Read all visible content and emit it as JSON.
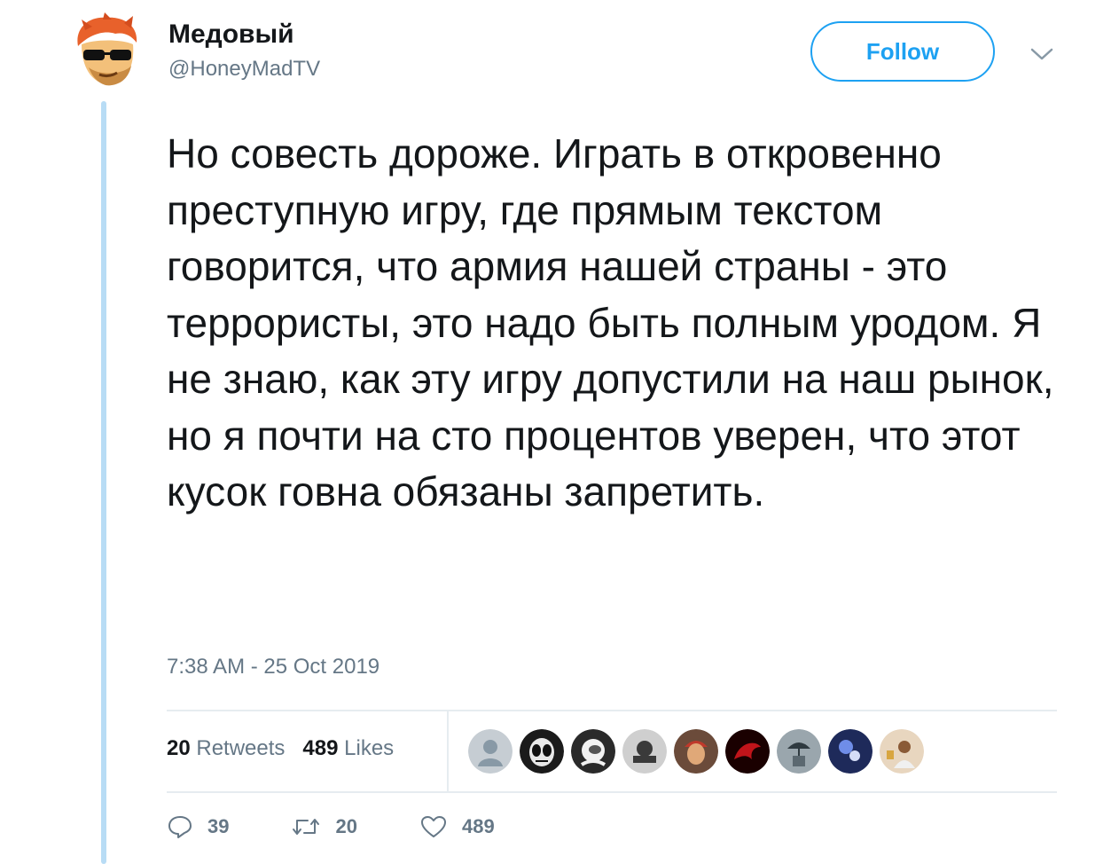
{
  "user": {
    "display_name": "Медовый",
    "handle": "@HoneyMadTV"
  },
  "follow_label": "Follow",
  "tweet": {
    "text": "Но совесть дороже. Играть в откровенно преступную игру, где прямым текстом говорится, что армия нашей страны - это террористы, это надо быть полным уродом. Я не знаю, как эту игру допустили на наш рынок, но я почти на сто процентов уверен, что этот кусок говна обязаны запретить.",
    "timestamp": "7:38 AM - 25 Oct 2019"
  },
  "stats": {
    "retweets_count": "20",
    "retweets_label": "Retweets",
    "likes_count": "489",
    "likes_label": "Likes"
  },
  "likers": [
    {
      "icon": "default-avatar",
      "color": "#c6cdd3"
    },
    {
      "icon": "alien-mask-avatar",
      "color": "#1b1b1b"
    },
    {
      "icon": "astronaut-avatar",
      "color": "#2a2a2a"
    },
    {
      "icon": "logo-badge-avatar",
      "color": "#cfcfcf"
    },
    {
      "icon": "man-in-cap-avatar",
      "color": "#6b4b3a"
    },
    {
      "icon": "red-dragon-avatar",
      "color": "#8a0f10"
    },
    {
      "icon": "umbrella-photo-avatar",
      "color": "#6c7a84"
    },
    {
      "icon": "concert-light-avatar",
      "color": "#1e2a5a"
    },
    {
      "icon": "portrait-photo-avatar",
      "color": "#c9a27a"
    }
  ],
  "actions": {
    "reply_count": "39",
    "retweet_count": "20",
    "like_count": "489"
  },
  "colors": {
    "accent": "#1da1f2",
    "secondary_text": "#657786",
    "thread_line": "#b8dcf5"
  }
}
